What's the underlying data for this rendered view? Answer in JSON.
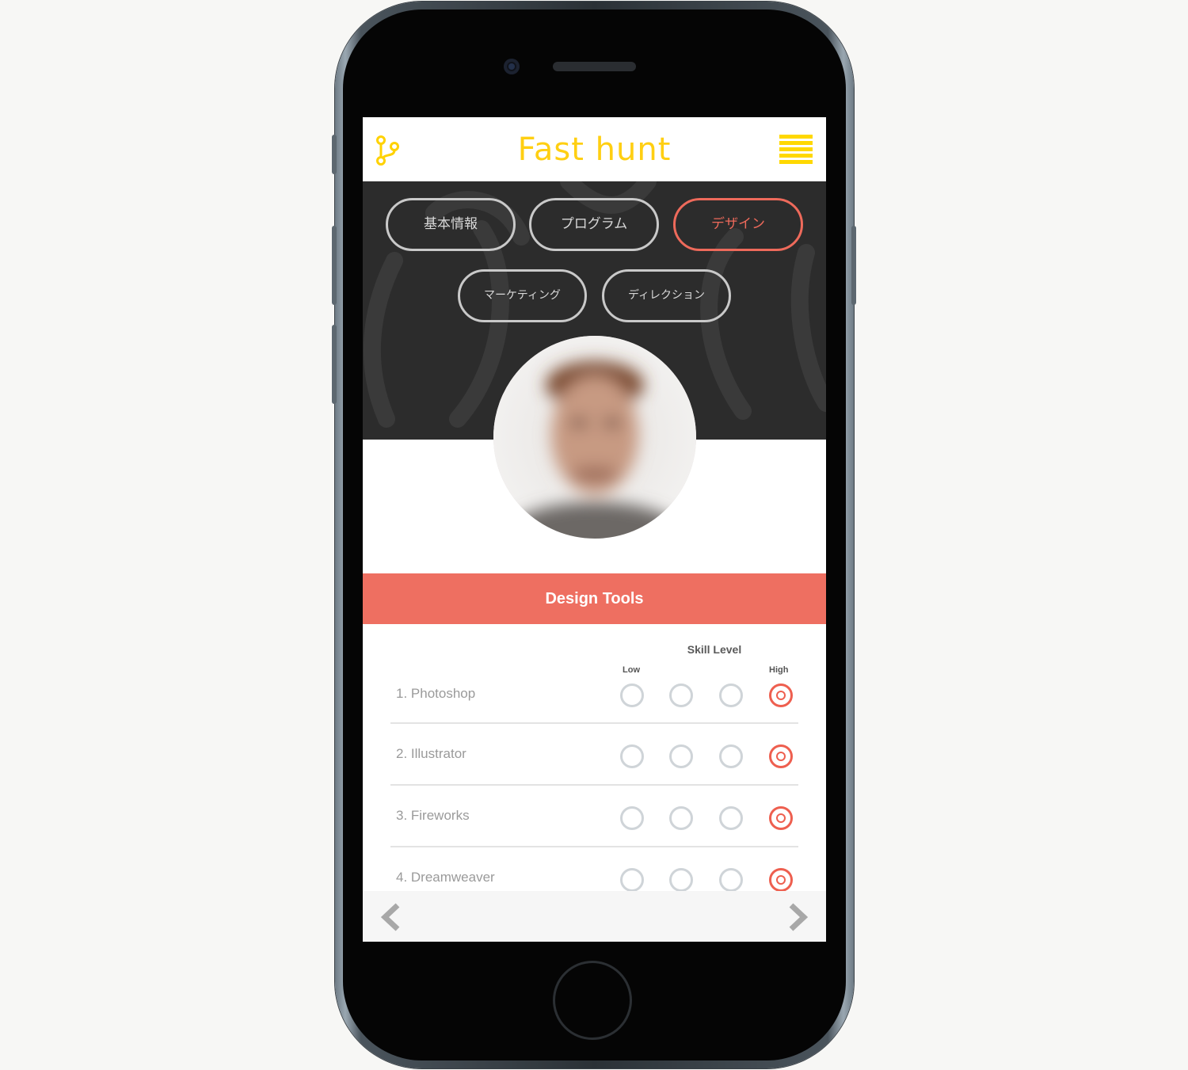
{
  "header": {
    "app_title": "Fast hunt",
    "logo_icon": "branch-icon",
    "menu_icon": "hamburger-menu-icon",
    "accent_color": "#ffd800"
  },
  "tabs": [
    {
      "label": "基本情報",
      "active": false
    },
    {
      "label": "プログラム",
      "active": false
    },
    {
      "label": "デザイン",
      "active": true
    },
    {
      "label": "マーケティング",
      "active": false
    },
    {
      "label": "ディレクション",
      "active": false
    }
  ],
  "profile": {
    "avatar_icon": "profile-photo"
  },
  "section": {
    "title": "Design Tools",
    "color": "#ee6f61"
  },
  "skill_table": {
    "header": "Skill Level",
    "low_label": "Low",
    "high_label": "High",
    "levels": 4,
    "rows": [
      {
        "name": "1. Photoshop",
        "level": 4
      },
      {
        "name": "2. Illustrator",
        "level": 4
      },
      {
        "name": "3. Fireworks",
        "level": 4
      },
      {
        "name": "4. Dreamweaver",
        "level": 4
      }
    ]
  },
  "footer": {
    "prev_icon": "chevron-left-icon",
    "next_icon": "chevron-right-icon"
  }
}
